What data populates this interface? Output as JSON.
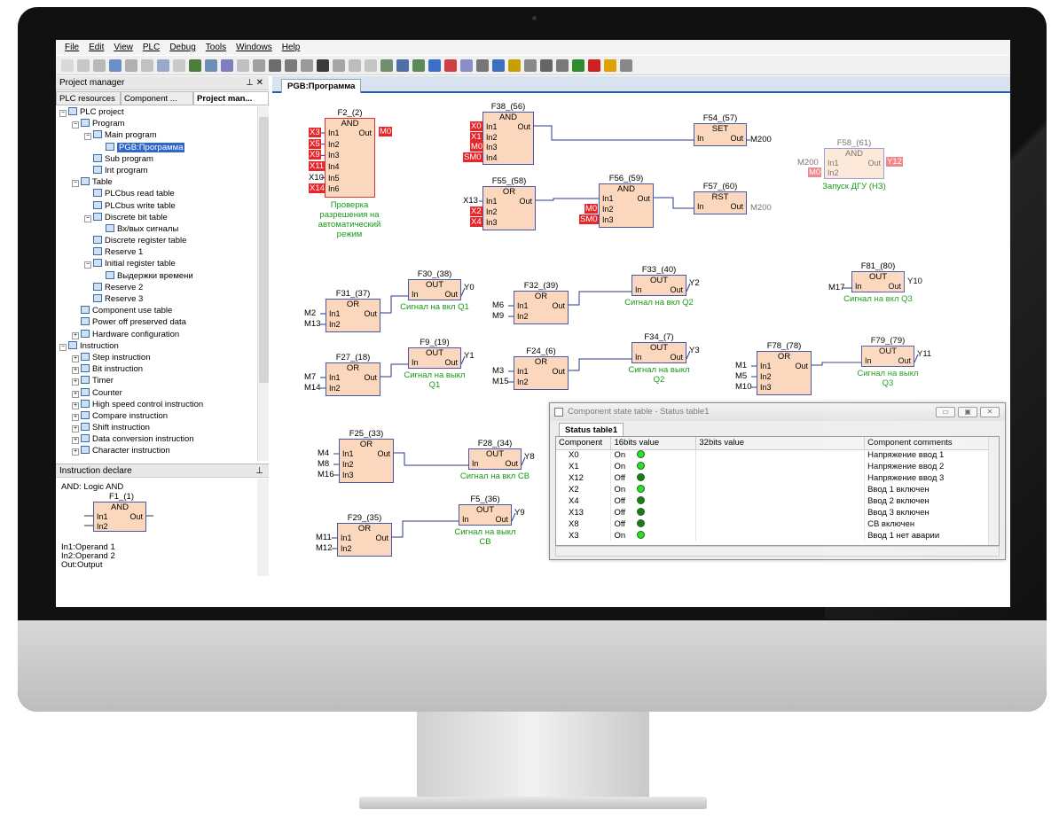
{
  "menu": [
    "File",
    "Edit",
    "View",
    "PLC",
    "Debug",
    "Tools",
    "Windows",
    "Help"
  ],
  "project_manager": {
    "title": "Project manager",
    "pin": "&#x2337; ✕",
    "tabs": [
      "PLC resources",
      "Component ...",
      "Project man..."
    ]
  },
  "tree": [
    {
      "label": "PLC project",
      "indent": 0,
      "exp": "-"
    },
    {
      "label": "Program",
      "indent": 1,
      "exp": "-"
    },
    {
      "label": "Main program",
      "indent": 2,
      "exp": "-"
    },
    {
      "label": "PGB:Программа",
      "indent": 3,
      "exp": "",
      "selected": true
    },
    {
      "label": "Sub program",
      "indent": 2,
      "exp": ""
    },
    {
      "label": "Int program",
      "indent": 2,
      "exp": ""
    },
    {
      "label": "Table",
      "indent": 1,
      "exp": "-"
    },
    {
      "label": "PLCbus read table",
      "indent": 2,
      "exp": ""
    },
    {
      "label": "PLCbus write table",
      "indent": 2,
      "exp": ""
    },
    {
      "label": "Discrete bit table",
      "indent": 2,
      "exp": "-"
    },
    {
      "label": "Вх/вых сигналы",
      "indent": 3,
      "exp": ""
    },
    {
      "label": "Discrete register table",
      "indent": 2,
      "exp": ""
    },
    {
      "label": "Reserve 1",
      "indent": 2,
      "exp": ""
    },
    {
      "label": "Initial register table",
      "indent": 2,
      "exp": "-"
    },
    {
      "label": "Выдержки времени",
      "indent": 3,
      "exp": ""
    },
    {
      "label": "Reserve 2",
      "indent": 2,
      "exp": ""
    },
    {
      "label": "Reserve 3",
      "indent": 2,
      "exp": ""
    },
    {
      "label": "Component use table",
      "indent": 1,
      "exp": ""
    },
    {
      "label": "Power off preserved data",
      "indent": 1,
      "exp": ""
    },
    {
      "label": "Hardware configuration",
      "indent": 1,
      "exp": "+"
    },
    {
      "label": "Instruction",
      "indent": 0,
      "exp": "-"
    },
    {
      "label": "Step instruction",
      "indent": 1,
      "exp": "+"
    },
    {
      "label": "Bit instruction",
      "indent": 1,
      "exp": "+"
    },
    {
      "label": "Timer",
      "indent": 1,
      "exp": "+"
    },
    {
      "label": "Counter",
      "indent": 1,
      "exp": "+"
    },
    {
      "label": "High speed control instruction",
      "indent": 1,
      "exp": "+"
    },
    {
      "label": "Compare instruction",
      "indent": 1,
      "exp": "+"
    },
    {
      "label": "Shift instruction",
      "indent": 1,
      "exp": "+"
    },
    {
      "label": "Data conversion instruction",
      "indent": 1,
      "exp": "+"
    },
    {
      "label": "Character instruction",
      "indent": 1,
      "exp": "+"
    }
  ],
  "instruction_declare": {
    "title": "Instruction declare",
    "desc": "AND: Logic AND",
    "block_id": "F1_(1)",
    "block_name": "AND",
    "in1": "In1",
    "in2": "In2",
    "out": "Out",
    "notes": [
      "In1:Operand 1",
      "In2:Operand 2",
      "Out:Output"
    ]
  },
  "doc_tab": "PGB:Программа",
  "blocks": [
    {
      "id": "F2_(2)",
      "name": "AND",
      "ins": [
        "In1",
        "In2",
        "In3",
        "In4",
        "In5",
        "In6"
      ],
      "out": "Out",
      "red": true
    },
    {
      "id": "F38_(56)",
      "name": "AND",
      "ins": [
        "In1",
        "In2",
        "In3",
        "In4"
      ],
      "out": "Out"
    },
    {
      "id": "F54_(57)",
      "name": "SET",
      "ins": [
        "In"
      ],
      "out": "Out"
    },
    {
      "id": "F58_(61)",
      "name": "AND",
      "ins": [
        "In1",
        "In2"
      ],
      "out": "Out",
      "faded": true
    },
    {
      "id": "F55_(58)",
      "name": "OR",
      "ins": [
        "In1",
        "In2",
        "In3"
      ],
      "out": "Out"
    },
    {
      "id": "F56_(59)",
      "name": "AND",
      "ins": [
        "In1",
        "In2",
        "In3"
      ],
      "out": "Out"
    },
    {
      "id": "F57_(60)",
      "name": "RST",
      "ins": [
        "In"
      ],
      "out": "Out"
    },
    {
      "id": "F30_(38)",
      "name": "OUT",
      "ins": [
        "In"
      ],
      "out": "Out"
    },
    {
      "id": "F31_(37)",
      "name": "OR",
      "ins": [
        "In1",
        "In2"
      ],
      "out": "Out"
    },
    {
      "id": "F32_(39)",
      "name": "OR",
      "ins": [
        "In1",
        "In2"
      ],
      "out": "Out"
    },
    {
      "id": "F33_(40)",
      "name": "OUT",
      "ins": [
        "In"
      ],
      "out": "Out"
    },
    {
      "id": "F81_(80)",
      "name": "OUT",
      "ins": [
        "In"
      ],
      "out": "Out"
    },
    {
      "id": "F9_(19)",
      "name": "OUT",
      "ins": [
        "In"
      ],
      "out": "Out"
    },
    {
      "id": "F27_(18)",
      "name": "OR",
      "ins": [
        "In1",
        "In2"
      ],
      "out": "Out"
    },
    {
      "id": "F24_(6)",
      "name": "OR",
      "ins": [
        "In1",
        "In2"
      ],
      "out": "Out"
    },
    {
      "id": "F34_(7)",
      "name": "OUT",
      "ins": [
        "In"
      ],
      "out": "Out"
    },
    {
      "id": "F78_(78)",
      "name": "OR",
      "ins": [
        "In1",
        "In2",
        "In3"
      ],
      "out": "Out"
    },
    {
      "id": "F79_(79)",
      "name": "OUT",
      "ins": [
        "In"
      ],
      "out": "Out"
    },
    {
      "id": "F25_(33)",
      "name": "OR",
      "ins": [
        "In1",
        "In2",
        "In3"
      ],
      "out": "Out"
    },
    {
      "id": "F28_(34)",
      "name": "OUT",
      "ins": [
        "In"
      ],
      "out": "Out"
    },
    {
      "id": "F29_(35)",
      "name": "OR",
      "ins": [
        "In1",
        "In2"
      ],
      "out": "Out"
    },
    {
      "id": "F5_(36)",
      "name": "OUT",
      "ins": [
        "In"
      ],
      "out": "Out"
    }
  ],
  "signals": {
    "f2": [
      "X3",
      "X5",
      "X9",
      "X11",
      "X10",
      "X14"
    ],
    "f2_out": "M0",
    "f38": [
      "X0",
      "X1",
      "M0",
      "SM0"
    ],
    "f54_out": "M200",
    "f58": [
      "M200",
      "M0"
    ],
    "f58_out": "Y12",
    "f55": [
      "X13",
      "X2",
      "X4"
    ],
    "f56": [
      "M0",
      "SM0"
    ],
    "f57_out": "M200",
    "f31": [
      "M2",
      "M13"
    ],
    "f30_out": "Y0",
    "f32": [
      "M6",
      "M9"
    ],
    "f33_out": "Y2",
    "f81_in": "M17",
    "f81_out": "Y10",
    "f27": [
      "M7",
      "M14"
    ],
    "f9_out": "Y1",
    "f24": [
      "M3",
      "M15"
    ],
    "f34_out": "Y3",
    "f78": [
      "M1",
      "M5",
      "M10"
    ],
    "f79_out": "Y11",
    "f25": [
      "M4",
      "M8",
      "M16"
    ],
    "f28_out": "Y8",
    "f29": [
      "M11",
      "M12"
    ],
    "f5_out": "Y9"
  },
  "comments": {
    "f2": [
      "Проверка",
      "разрешения на",
      "автоматический",
      "режим"
    ],
    "f58": [
      "Запуск ДГУ (НЗ)"
    ],
    "f30": [
      "Сигнал на вкл Q1"
    ],
    "f33": [
      "Сигнал на вкл Q2"
    ],
    "f81": [
      "Сигнал на вкл Q3"
    ],
    "f9": [
      "Сигнал на выкл",
      "Q1"
    ],
    "f34": [
      "Сигнал на выкл",
      "Q2"
    ],
    "f79": [
      "Сигнал на выкл",
      "Q3"
    ],
    "f28": [
      "Сигнал на вкл СВ"
    ],
    "f5": [
      "Сигнал на выкл",
      "СВ"
    ]
  },
  "status_window": {
    "title": "Component state table - Status table1",
    "tab": "Status table1",
    "columns": [
      "Component",
      "16bits value",
      "32bits value",
      "Component comments"
    ],
    "rows": [
      {
        "component": "X0",
        "value": "On",
        "state": "on",
        "comment": "Напряжение ввод 1"
      },
      {
        "component": "X1",
        "value": "On",
        "state": "on",
        "comment": "Напряжение ввод 2"
      },
      {
        "component": "X12",
        "value": "Off",
        "state": "off",
        "comment": "Напряжение ввод 3"
      },
      {
        "component": "X2",
        "value": "On",
        "state": "on",
        "comment": "Ввод 1 включен"
      },
      {
        "component": "X4",
        "value": "Off",
        "state": "off",
        "comment": "Ввод 2 включен"
      },
      {
        "component": "X13",
        "value": "Off",
        "state": "off",
        "comment": "Ввод 3 включен"
      },
      {
        "component": "X8",
        "value": "Off",
        "state": "off",
        "comment": "СВ включен"
      },
      {
        "component": "X3",
        "value": "On",
        "state": "on",
        "comment": "Ввод 1 нет аварии"
      }
    ]
  },
  "colors": {
    "block_fill": "#fbd8bd",
    "block_border": "#4a57a8",
    "signal_red": "#e6262b",
    "comment_green": "#159a15",
    "led_on": "#28e028",
    "led_off": "#1d7a1d"
  }
}
